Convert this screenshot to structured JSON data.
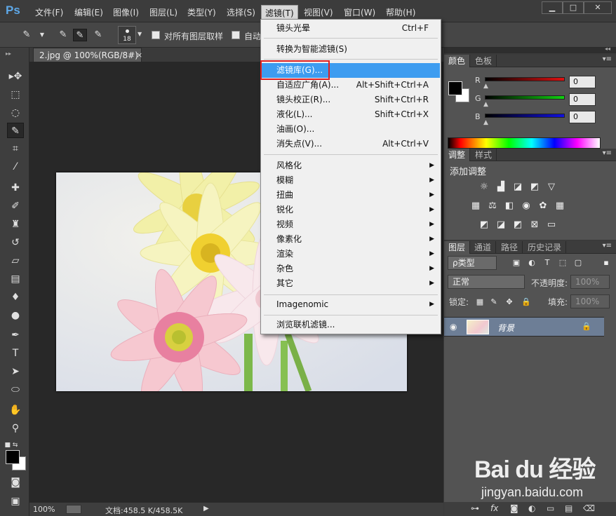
{
  "app": {
    "logo": "Ps"
  },
  "menubar": {
    "items": [
      "文件(F)",
      "编辑(E)",
      "图像(I)",
      "图层(L)",
      "类型(Y)",
      "选择(S)",
      "滤镜(T)",
      "视图(V)",
      "窗口(W)",
      "帮助(H)"
    ],
    "active_index": 6,
    "window_buttons": [
      "▁",
      "□",
      "✕"
    ]
  },
  "options": {
    "brush_size": "18",
    "sample_all_layers": "对所有图层取样",
    "auto": "自动"
  },
  "document": {
    "tab_title": "2.jpg @ 100%(RGB/8#)",
    "tab_close": "×",
    "zoom": "100%",
    "doc_info": "文档:458.5 K/458.5K"
  },
  "filter_menu": {
    "items": [
      {
        "label": "镜头光晕",
        "shortcut": "Ctrl+F"
      },
      {
        "label": "转换为智能滤镜(S)",
        "shortcut": ""
      },
      {
        "label": "滤镜库(G)...",
        "shortcut": ""
      },
      {
        "label": "自适应广角(A)...",
        "shortcut": "Alt+Shift+Ctrl+A"
      },
      {
        "label": "镜头校正(R)...",
        "shortcut": "Shift+Ctrl+R"
      },
      {
        "label": "液化(L)...",
        "shortcut": "Shift+Ctrl+X"
      },
      {
        "label": "油画(O)...",
        "shortcut": ""
      },
      {
        "label": "消失点(V)...",
        "shortcut": "Alt+Ctrl+V"
      },
      {
        "label": "风格化",
        "shortcut": ""
      },
      {
        "label": "模糊",
        "shortcut": ""
      },
      {
        "label": "扭曲",
        "shortcut": ""
      },
      {
        "label": "锐化",
        "shortcut": ""
      },
      {
        "label": "视频",
        "shortcut": ""
      },
      {
        "label": "像素化",
        "shortcut": ""
      },
      {
        "label": "渲染",
        "shortcut": ""
      },
      {
        "label": "杂色",
        "shortcut": ""
      },
      {
        "label": "其它",
        "shortcut": ""
      },
      {
        "label": "Imagenomic",
        "shortcut": ""
      },
      {
        "label": "浏览联机滤镜...",
        "shortcut": ""
      }
    ],
    "submenu_arrow": "▶",
    "highlighted_index": 2
  },
  "color_panel": {
    "tabs": [
      "颜色",
      "色板"
    ],
    "channels": [
      {
        "label": "R",
        "value": "0",
        "color": "#e01010"
      },
      {
        "label": "G",
        "value": "0",
        "color": "#10d010"
      },
      {
        "label": "B",
        "value": "0",
        "color": "#1010e0"
      }
    ]
  },
  "adjust_panel": {
    "tabs": [
      "调整",
      "样式"
    ],
    "title": "添加调整"
  },
  "layers_panel": {
    "tabs": [
      "图层",
      "通道",
      "路径",
      "历史记录"
    ],
    "filter_kind": "ρ类型",
    "blend_mode": "正常",
    "opacity_label": "不透明度:",
    "opacity_value": "100%",
    "lock_label": "锁定:",
    "fill_label": "填充:",
    "fill_value": "100%",
    "layer_name": "背景"
  },
  "watermark": {
    "logo": "Bai du 经验",
    "url": "jingyan.baidu.com"
  },
  "colors": {
    "highlight": "#3d9cf0",
    "callout": "#e02020"
  }
}
